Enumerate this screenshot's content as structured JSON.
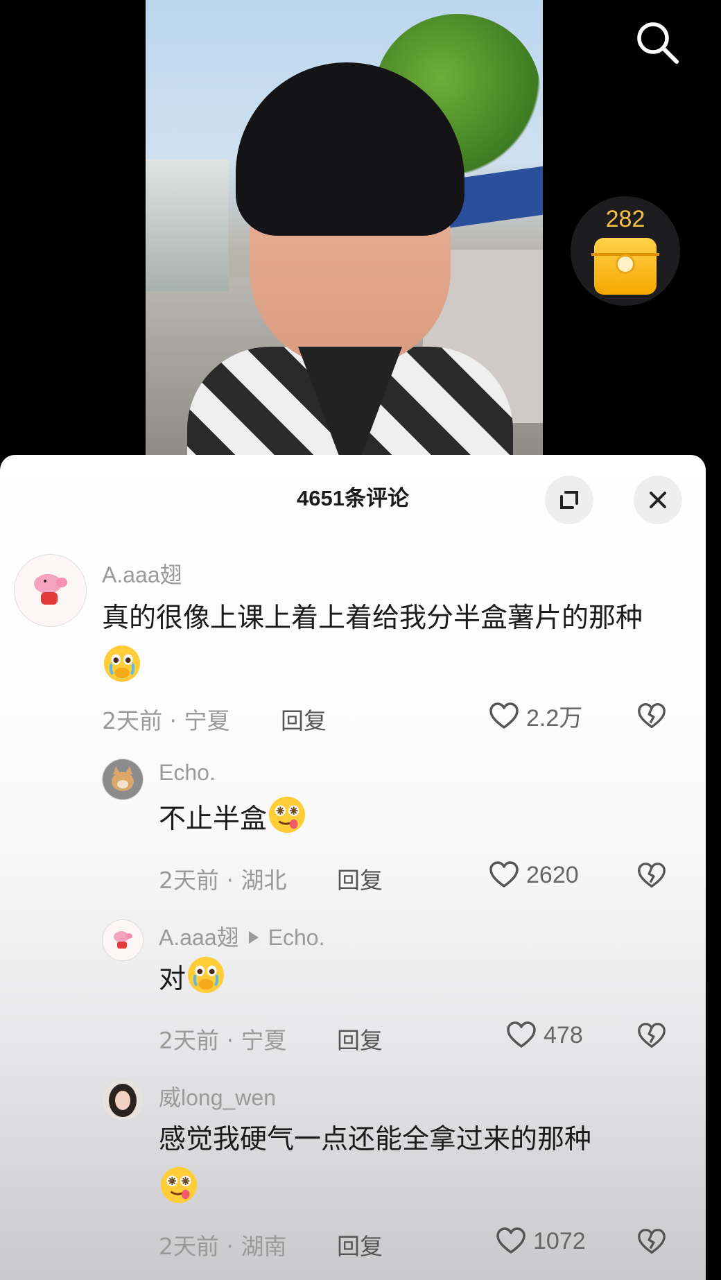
{
  "video": {
    "coin_count": "282"
  },
  "comments_panel": {
    "title": "4651条评论",
    "comments": [
      {
        "username": "A.aaa翅",
        "text": "真的很像上课上着上着给我分半盒薯片的那种",
        "time": "2天前",
        "location": "宁夏",
        "reply_label": "回复",
        "likes": "2.2万"
      },
      {
        "username": "Echo.",
        "text": "不止半盒",
        "time": "2天前",
        "location": "湖北",
        "reply_label": "回复",
        "likes": "2620"
      },
      {
        "username": "A.aaa翅",
        "reply_to": "Echo.",
        "text": "对",
        "time": "2天前",
        "location": "宁夏",
        "reply_label": "回复",
        "likes": "478"
      },
      {
        "username": "威long_wen",
        "text": "感觉我硬气一点还能全拿过来的那种",
        "time": "2天前",
        "location": "湖南",
        "reply_label": "回复",
        "likes": "1072"
      }
    ]
  },
  "colors": {
    "accent_coin": "#f5c043",
    "sheet_bg": "#ffffff",
    "meta_gray": "#9a9a9a"
  },
  "icons": [
    "search-icon",
    "red-envelope-icon",
    "expand-icon",
    "close-icon",
    "heart-icon",
    "broken-heart-icon",
    "crying-emoji",
    "drooling-emoji",
    "reply-arrow-icon"
  ]
}
